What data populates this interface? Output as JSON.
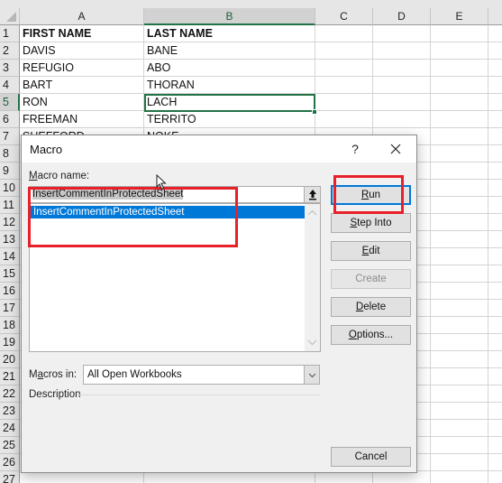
{
  "spreadsheet": {
    "columns": [
      "A",
      "B",
      "C",
      "D",
      "E"
    ],
    "rows": [
      "1",
      "2",
      "3",
      "4",
      "5",
      "6",
      "7",
      "8",
      "9",
      "10",
      "11",
      "12",
      "13",
      "14",
      "15",
      "16",
      "17",
      "18",
      "19",
      "20",
      "21",
      "22",
      "23",
      "24",
      "25",
      "26",
      "27"
    ],
    "cells": [
      {
        "a": "FIRST NAME",
        "b": "LAST NAME"
      },
      {
        "a": "DAVIS",
        "b": "BANE"
      },
      {
        "a": "REFUGIO",
        "b": "ABO"
      },
      {
        "a": "BART",
        "b": "THORAN"
      },
      {
        "a": "RON",
        "b": "LACH"
      },
      {
        "a": "FREEMAN",
        "b": "TERRITO"
      },
      {
        "a": "SHEFFORD",
        "b": "NOKE"
      }
    ],
    "active_cell": "B5",
    "accent_color": "#217346"
  },
  "dialog": {
    "title": "Macro",
    "help_label": "?",
    "macro_name_label_accel": "M",
    "macro_name_label_rest": "acro name:",
    "macro_name_value": "InsertCommentInProtectedSheet",
    "macro_list": [
      "InsertCommentInProtectedSheet"
    ],
    "selected_macro": "InsertCommentInProtectedSheet",
    "buttons": {
      "run": {
        "accel": "R",
        "rest": "un"
      },
      "step_into": {
        "accel": "S",
        "rest": "tep Into"
      },
      "edit": {
        "accel": "E",
        "rest": "dit"
      },
      "create": {
        "label": "Create",
        "disabled": true
      },
      "delete": {
        "accel": "D",
        "rest": "elete"
      },
      "options": {
        "accel": "O",
        "rest": "ptions..."
      },
      "cancel": {
        "label": "Cancel"
      }
    },
    "macros_in_label_pre": "M",
    "macros_in_label_accel": "a",
    "macros_in_label_rest": "cros in:",
    "macros_in_value": "All Open Workbooks",
    "description_label": "Description",
    "description_text": ""
  },
  "annotations": {
    "highlight_color": "#e8202a"
  }
}
